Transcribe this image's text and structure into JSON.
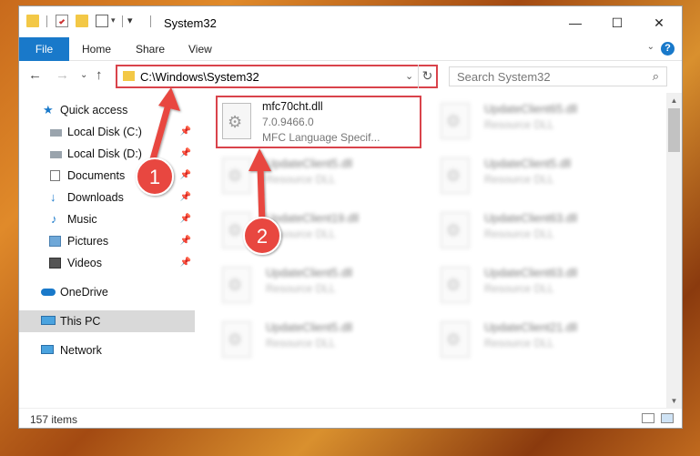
{
  "window": {
    "title": "System32",
    "controls": {
      "minimize": "—",
      "maximize": "☐",
      "close": "✕"
    }
  },
  "ribbon": {
    "tabs": [
      "File",
      "Home",
      "Share",
      "View"
    ],
    "help": "?",
    "collapse": "⌄"
  },
  "navigation": {
    "back": "←",
    "forward": "→",
    "recent": "⌄",
    "up": "↑",
    "address": "C:\\Windows\\System32",
    "address_dropdown": "⌄",
    "refresh": "↻",
    "search_placeholder": "Search System32",
    "search_icon": "⌕"
  },
  "sidebar": {
    "quick_access": "Quick access",
    "items": [
      {
        "label": "Local Disk (C:)",
        "icon": "drive-icon",
        "pinned": true
      },
      {
        "label": "Local Disk (D:)",
        "icon": "drive-icon",
        "pinned": true
      },
      {
        "label": "Documents",
        "icon": "documents-icon",
        "pinned": true
      },
      {
        "label": "Downloads",
        "icon": "downloads-icon",
        "pinned": true
      },
      {
        "label": "Music",
        "icon": "music-icon",
        "pinned": true
      },
      {
        "label": "Pictures",
        "icon": "pictures-icon",
        "pinned": true
      },
      {
        "label": "Videos",
        "icon": "videos-icon",
        "pinned": true
      }
    ],
    "onedrive": "OneDrive",
    "this_pc": "This PC",
    "network": "Network",
    "pin_glyph": "📌"
  },
  "files": {
    "highlighted": {
      "name": "mfc70cht.dll",
      "version": "7.0.9466.0",
      "description": "MFC Language Specif..."
    },
    "right_column": [
      {
        "name": "UpdateClient65.dll",
        "type": "Resource DLL"
      },
      {
        "name": "UpdateClient5.dll",
        "type": "Resource DLL"
      },
      {
        "name": "UpdateClient63.dll",
        "type": "Resource DLL"
      },
      {
        "name": "UpdateClient63.dll",
        "type": "Resource DLL"
      },
      {
        "name": "UpdateClient21.dll",
        "type": "Resource DLL"
      }
    ],
    "left_column": [
      {
        "name": "UpdateClient5.dll",
        "type": "Resource DLL"
      },
      {
        "name": "UpdateClient19.dll",
        "type": "Resource DLL"
      },
      {
        "name": "UpdateClient5.dll",
        "type": "Resource DLL"
      },
      {
        "name": "UpdateClient5.dll",
        "type": "Resource DLL"
      }
    ]
  },
  "status": {
    "item_count": "157 items"
  },
  "annotations": {
    "step1": "1",
    "step2": "2"
  },
  "colors": {
    "accent": "#1979ca",
    "highlight": "#d9434b",
    "folder": "#f3c846"
  }
}
